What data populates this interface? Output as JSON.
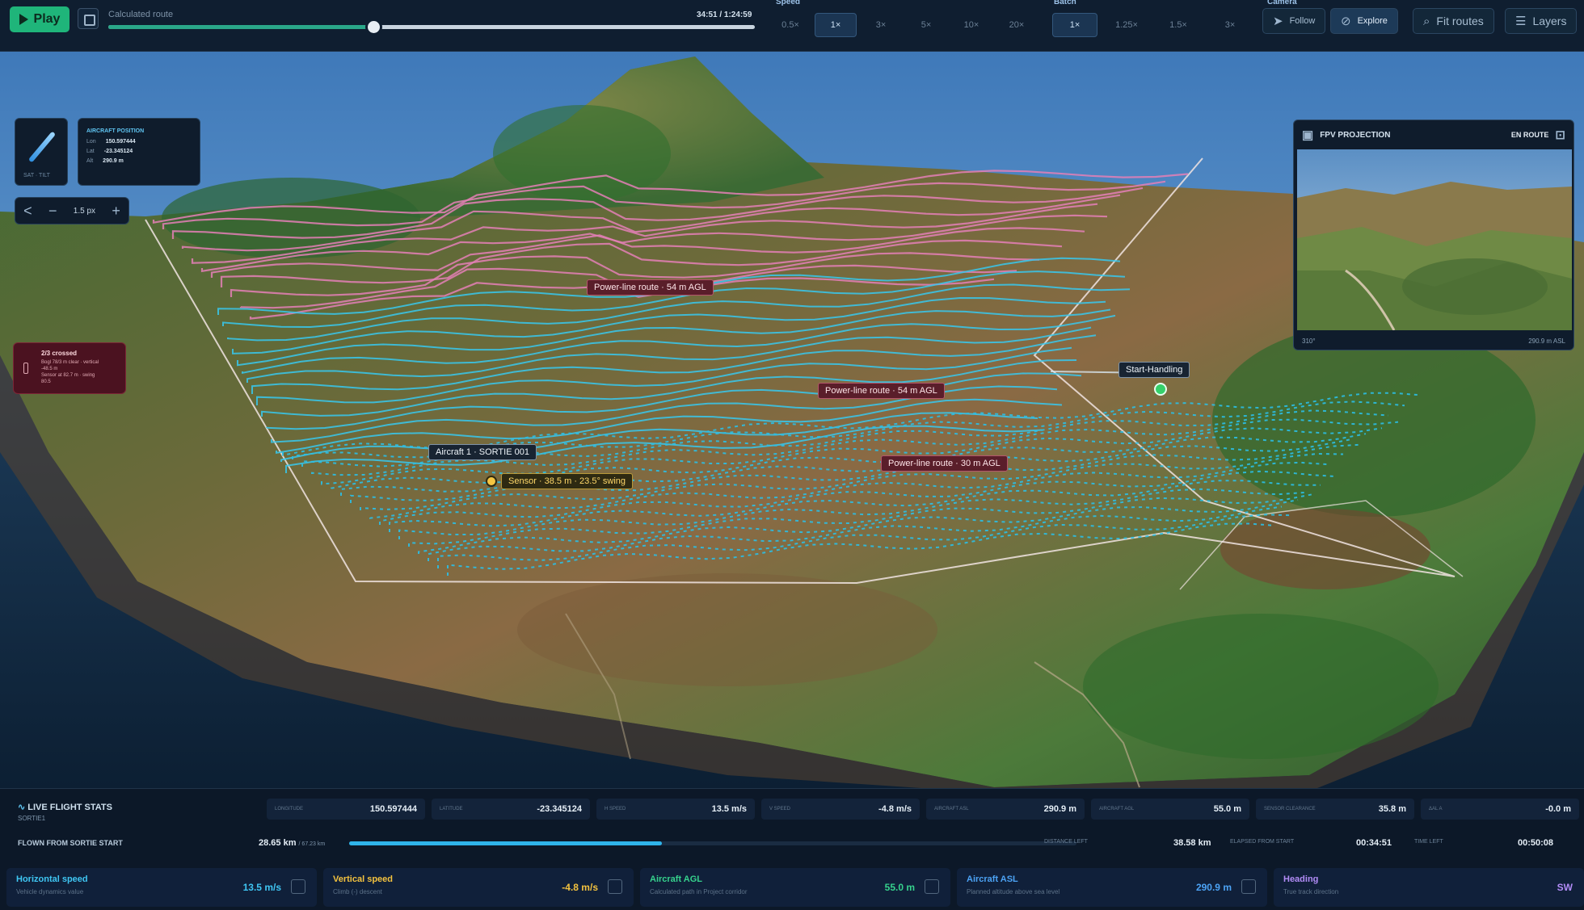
{
  "topbar": {
    "play_label": "Play",
    "route_label": "Calculated route",
    "time_label": "34:51 / 1:24:59",
    "progress": 0.41,
    "speed_title": "Speed",
    "speed_options": [
      "0.5×",
      "1×",
      "3×",
      "5×",
      "10×",
      "20×"
    ],
    "speed_active": 1,
    "batch_title": "Batch",
    "batch_options": [
      "1×",
      "1.25×",
      "1.5×",
      "3×"
    ],
    "batch_active": 0,
    "camera_title": "Camera",
    "follow_label": "Follow",
    "explore_label": "Explore",
    "fit_routes_label": "Fit routes",
    "layers_label": "Layers"
  },
  "map": {
    "compass_label": "N",
    "compass_caption": "SAT · TILT",
    "position": {
      "title": "AIRCRAFT POSITION",
      "rows": [
        {
          "key": "Lon",
          "value": "150.597444"
        },
        {
          "key": "Lat",
          "value": "-23.345124"
        },
        {
          "key": "Alt",
          "value": "290.9 m"
        }
      ]
    },
    "zoom_value": "1.5 px",
    "warning": {
      "title": "2/3 crossed",
      "lines": [
        "Bogl 78/3 m clear · vertical",
        "-48.5 m",
        "Sensor at 82.7 m · swing",
        "80.5"
      ]
    },
    "fpv": {
      "title": "FPV PROJECTION",
      "status": "EN ROUTE",
      "heading": "310°",
      "altitude": "290.9 m ASL"
    },
    "labels": {
      "route_54_top": "Power-line route · 54 m AGL",
      "route_54": "Power-line route · 54 m AGL",
      "route_30": "Power-line route · 30 m AGL",
      "start": "Start-Handling",
      "aircraft": "Aircraft 1 · SORTIE 001",
      "sensor": "Sensor · 38.5 m · 23.5° swing"
    }
  },
  "bottom": {
    "title": "LIVE FLIGHT STATS",
    "subtitle": "SORTIE1",
    "stats": [
      {
        "label": "LONGITUDE",
        "value": "150.597444"
      },
      {
        "label": "LATITUDE",
        "value": "-23.345124"
      },
      {
        "label": "H SPEED",
        "value": "13.5 m/s"
      },
      {
        "label": "V SPEED",
        "value": "-4.8 m/s"
      },
      {
        "label": "AIRCRAFT ASL",
        "value": "290.9 m"
      },
      {
        "label": "AIRCRAFT AGL",
        "value": "55.0 m"
      },
      {
        "label": "SENSOR CLEARANCE",
        "value": "35.8 m"
      },
      {
        "label": "ΔAL A",
        "value": "-0.0 m"
      }
    ],
    "flown": {
      "label": "FLOWN FROM SORTIE START",
      "value": "28.65 km",
      "total": "/ 67.23 km",
      "progress": 0.43,
      "distance_left_label": "DISTANCE LEFT",
      "distance_left": "38.58 km",
      "elapsed_label": "ELAPSED FROM START",
      "elapsed": "00:34:51",
      "time_left_label": "TIME LEFT",
      "time_left": "00:50:08"
    },
    "cards": [
      {
        "title": "Horizontal speed",
        "sub": "Vehicle dynamics value",
        "value": "13.5 m/s",
        "color": "#3fc6f3"
      },
      {
        "title": "Vertical speed",
        "sub": "Climb (-) descent",
        "value": "-4.8 m/s",
        "color": "#f3c23f"
      },
      {
        "title": "Aircraft AGL",
        "sub": "Calculated path in Project corridor",
        "value": "55.0 m",
        "color": "#36d28d"
      },
      {
        "title": "Aircraft ASL",
        "sub": "Planned altitude above sea level",
        "value": "290.9 m",
        "color": "#4ca3f5"
      },
      {
        "title": "Heading",
        "sub": "True track direction",
        "value": "SW",
        "color": "#b28cf7"
      }
    ]
  },
  "colors": {
    "accent": "#1fb57a",
    "pink_route": "#e47fb6",
    "cyan_route": "#37c8ef",
    "dashed_route": "#2bbfe6",
    "start_dot": "#35d06a"
  }
}
